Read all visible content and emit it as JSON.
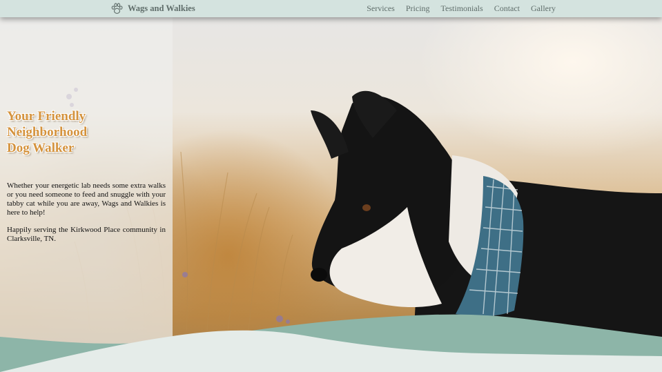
{
  "nav": {
    "brand": "Wags and Walkies",
    "brand_icon": "paw-icon",
    "links": [
      "Services",
      "Pricing",
      "Testimonials",
      "Contact",
      "Gallery"
    ]
  },
  "hero": {
    "headline_lines": [
      "Your Friendly",
      "Neighborhood",
      "Dog Walker"
    ],
    "paragraph1": "Whether your energetic lab needs some extra walks or you need someone to feed and snuggle with your tabby cat while you are away, Wags and Walkies is here to help!",
    "paragraph2": "Happily serving the Kirkwood Place community in Clarksville, TN."
  },
  "colors": {
    "nav_bg": "#d4e3df",
    "nav_text": "#5f6d6a",
    "headline": "#d4923c",
    "wave_teal": "#8db5a8",
    "wave_light": "#e5ece9"
  }
}
